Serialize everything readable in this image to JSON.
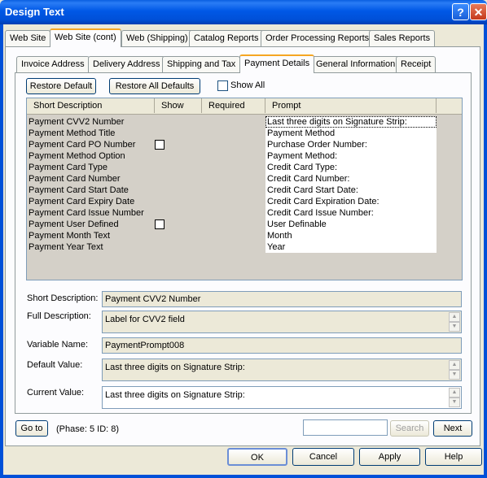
{
  "window": {
    "title": "Design Text"
  },
  "tabs_top": [
    {
      "label": "Web Site"
    },
    {
      "label": "Web Site (cont)"
    },
    {
      "label": "Web (Shipping)"
    },
    {
      "label": "Catalog Reports"
    },
    {
      "label": "Order Processing Reports"
    },
    {
      "label": "Sales Reports"
    }
  ],
  "tabs_sub": [
    {
      "label": "Invoice Address"
    },
    {
      "label": "Delivery Address"
    },
    {
      "label": "Shipping and Tax"
    },
    {
      "label": "Payment Details"
    },
    {
      "label": "General Information"
    },
    {
      "label": "Receipt"
    }
  ],
  "toolbar": {
    "restore_default": "Restore Default",
    "restore_all_defaults": "Restore All Defaults",
    "show_all": "Show All"
  },
  "grid": {
    "columns": [
      "Short Description",
      "Show",
      "Required",
      "Prompt"
    ],
    "rows": [
      {
        "desc": "Payment CVV2 Number",
        "show": false,
        "prompt": "Last three digits on Signature Strip:"
      },
      {
        "desc": "Payment Method Title",
        "show": false,
        "prompt": "Payment Method"
      },
      {
        "desc": "Payment Card PO Number",
        "show": true,
        "prompt": "Purchase Order Number:"
      },
      {
        "desc": "Payment Method Option",
        "show": false,
        "prompt": "Payment Method:"
      },
      {
        "desc": "Payment Card Type",
        "show": false,
        "prompt": "Credit Card Type:"
      },
      {
        "desc": "Payment Card Number",
        "show": false,
        "prompt": "Credit Card Number:"
      },
      {
        "desc": "Payment Card Start Date",
        "show": false,
        "prompt": "Credit Card Start Date:"
      },
      {
        "desc": "Payment Card Expiry Date",
        "show": false,
        "prompt": "Credit Card Expiration Date:"
      },
      {
        "desc": "Payment Card Issue Number",
        "show": false,
        "prompt": "Credit Card Issue Number:"
      },
      {
        "desc": "Payment User Defined",
        "show": true,
        "prompt": "User Definable"
      },
      {
        "desc": "Payment Month Text",
        "show": false,
        "prompt": "Month"
      },
      {
        "desc": "Payment Year Text",
        "show": false,
        "prompt": "Year"
      }
    ]
  },
  "details": {
    "short_description_label": "Short Description:",
    "short_description_value": "Payment CVV2 Number",
    "full_description_label": "Full Description:",
    "full_description_value": "Label for CVV2 field",
    "variable_name_label": "Variable Name:",
    "variable_name_value": "PaymentPrompt008",
    "default_value_label": "Default Value:",
    "default_value_value": "Last three digits on Signature Strip:",
    "current_value_label": "Current Value:",
    "current_value_value": "Last three digits on Signature Strip:"
  },
  "nav": {
    "goto_label": "Go to",
    "status_text": "(Phase: 5   ID: 8)",
    "search_label": "Search",
    "next_label": "Next"
  },
  "footer": {
    "ok": "OK",
    "cancel": "Cancel",
    "apply": "Apply",
    "help": "Help"
  }
}
